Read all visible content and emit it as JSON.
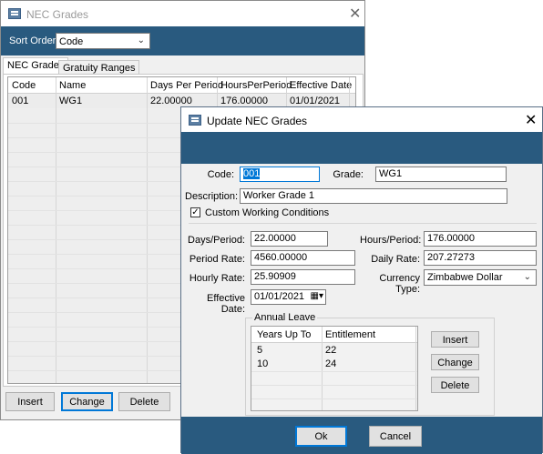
{
  "back_window": {
    "title": "NEC Grades",
    "sort_order_label": "Sort Order",
    "sort_order_value": "Code",
    "tabs": [
      {
        "label": "NEC Grades",
        "active": true
      },
      {
        "label": "Gratuity Ranges",
        "active": false
      }
    ],
    "grid": {
      "columns": [
        "Code",
        "Name",
        "Days Per Period",
        "HoursPerPeriod",
        "Effective Date"
      ],
      "rows": [
        [
          "001",
          "WG1",
          "22.00000",
          "176.00000",
          "01/01/2021"
        ]
      ]
    },
    "buttons": {
      "insert": "Insert",
      "change": "Change",
      "delete": "Delete"
    }
  },
  "dialog": {
    "title": "Update NEC Grades",
    "fields": {
      "code_label": "Code:",
      "code_value": "001",
      "grade_label": "Grade:",
      "grade_value": "WG1",
      "description_label": "Description:",
      "description_value": "Worker Grade 1",
      "custom_conditions_label": "Custom Working Conditions",
      "custom_conditions_checked": true,
      "days_label": "Days/Period:",
      "days_value": "22.00000",
      "hours_label": "Hours/Period:",
      "hours_value": "176.00000",
      "period_rate_label": "Period Rate:",
      "period_rate_value": "4560.00000",
      "daily_rate_label": "Daily Rate:",
      "daily_rate_value": "207.27273",
      "hourly_rate_label": "Hourly Rate:",
      "hourly_rate_value": "25.90909",
      "currency_label": "Currency Type:",
      "currency_value": "Zimbabwe Dollar",
      "effective_date_label": "Effective Date:",
      "effective_date_value": "01/01/2021"
    },
    "annual_leave": {
      "group_label": "Annual Leave",
      "columns": [
        "Years Up To",
        "Entitlement"
      ],
      "rows": [
        [
          "5",
          "22"
        ],
        [
          "10",
          "24"
        ]
      ],
      "buttons": {
        "insert": "Insert",
        "change": "Change",
        "delete": "Delete"
      }
    },
    "footer": {
      "ok": "Ok",
      "cancel": "Cancel"
    }
  }
}
